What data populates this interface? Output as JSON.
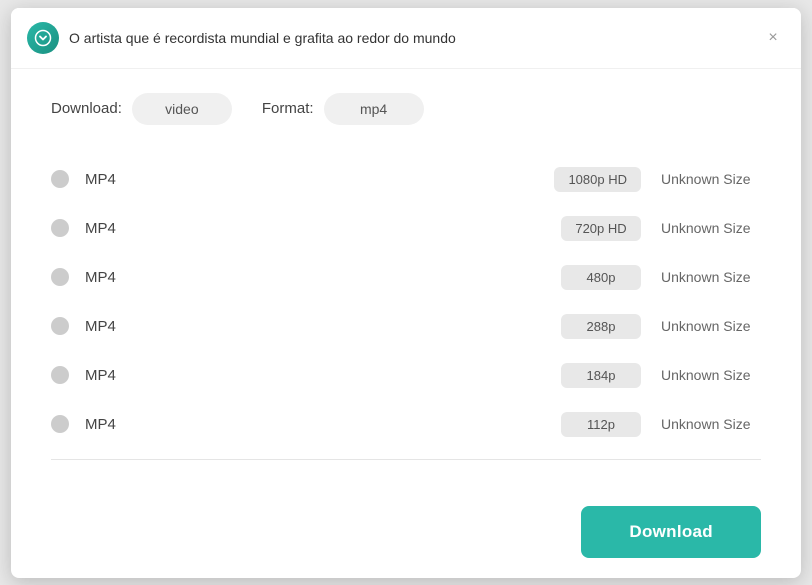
{
  "window": {
    "title": "O artista que é recordista mundial e grafita ao redor do mundo",
    "close_label": "×"
  },
  "controls": {
    "download_label": "Download:",
    "download_value": "video",
    "format_label": "Format:",
    "format_value": "mp4"
  },
  "options": [
    {
      "format": "MP4",
      "resolution": "1080p HD",
      "size": "Unknown Size"
    },
    {
      "format": "MP4",
      "resolution": "720p HD",
      "size": "Unknown Size"
    },
    {
      "format": "MP4",
      "resolution": "480p",
      "size": "Unknown Size"
    },
    {
      "format": "MP4",
      "resolution": "288p",
      "size": "Unknown Size"
    },
    {
      "format": "MP4",
      "resolution": "184p",
      "size": "Unknown Size"
    },
    {
      "format": "MP4",
      "resolution": "112p",
      "size": "Unknown Size"
    }
  ],
  "footer": {
    "download_button": "Download"
  }
}
